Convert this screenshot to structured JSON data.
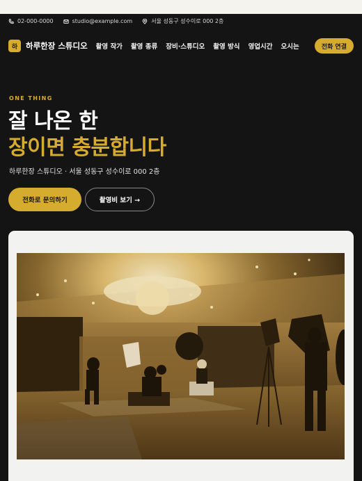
{
  "contact": {
    "phone": "02-000-0000",
    "email": "studio@example.com",
    "address": "서울 성동구 성수이로 000 2층"
  },
  "header": {
    "logo_mark": "하",
    "brand": "하루한장 스튜디오",
    "nav": [
      "촬영 작가",
      "촬영 종류",
      "장비·스튜디오",
      "촬영 방식",
      "영업시간",
      "오시는"
    ],
    "call_label": "전화 연결"
  },
  "hero": {
    "eyebrow": "ONE THING",
    "headline_line1": "잘 나온 한",
    "headline_line2": "장이면 충분합니다",
    "subtitle": "하루한장 스튜디오 · 서울 성동구 성수이로 000 2층",
    "primary_cta": "전화로 문의하기",
    "secondary_cta": "촬영비 보기 →"
  },
  "colors": {
    "accent": "#d6ac2e",
    "background": "#141414"
  },
  "icons": [
    "phone-icon",
    "mail-icon",
    "location-pin-icon"
  ]
}
